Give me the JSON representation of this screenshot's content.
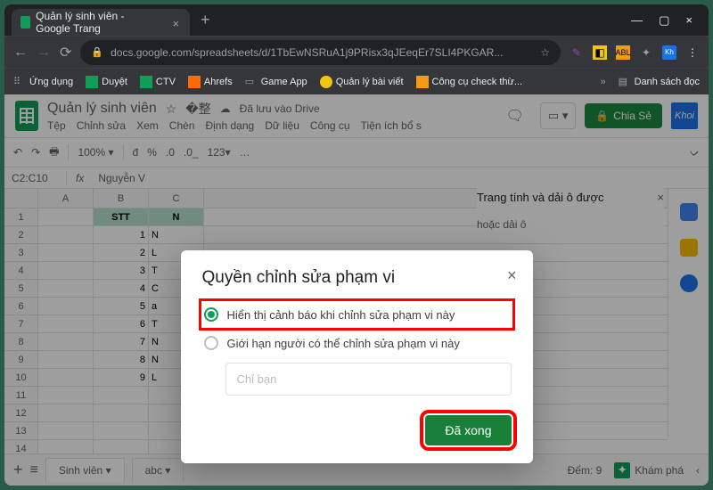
{
  "browser": {
    "tab_title": "Quản lý sinh viên - Google Trang",
    "url": "docs.google.com/spreadsheets/d/1TbEwNSRuA1j9PRisx3qJEeqEr7SLI4PKGAR...",
    "bookmarks": {
      "apps": "Ứng dụng",
      "items": [
        "Duyệt",
        "CTV",
        "Ahrefs",
        "Game App",
        "Quản lý bài viết",
        "Công cụ check thừ..."
      ],
      "overflow": "»",
      "reading_list": "Danh sách đọc"
    }
  },
  "doc": {
    "title": "Quản lý sinh viên",
    "saved": "Đã lưu vào Drive",
    "menus": [
      "Tệp",
      "Chỉnh sửa",
      "Xem",
      "Chèn",
      "Định dạng",
      "Dữ liệu",
      "Công cụ",
      "Tiện ích bổ s"
    ],
    "share": "Chia Sẻ",
    "avatar": "Khoi"
  },
  "toolbar": {
    "zoom": "100%",
    "currency": "đ",
    "percent": "%",
    "dec_dec": ".0",
    "dec_inc": ".0_",
    "num_format": "123",
    "more": "…",
    "expand": "ᨆ"
  },
  "formula": {
    "name_box": "C2:C10",
    "fx": "fx",
    "value": "Nguyễn V"
  },
  "grid": {
    "columns": [
      "A",
      "B",
      "C"
    ],
    "header_row": {
      "b": "STT",
      "c": "N"
    },
    "rows": [
      {
        "n": "1",
        "b": "",
        "c": ""
      },
      {
        "n": "2",
        "b": "1",
        "c": "N"
      },
      {
        "n": "3",
        "b": "2",
        "c": "L"
      },
      {
        "n": "4",
        "b": "3",
        "c": "T"
      },
      {
        "n": "5",
        "b": "4",
        "c": "C"
      },
      {
        "n": "6",
        "b": "5",
        "c": "a"
      },
      {
        "n": "7",
        "b": "6",
        "c": "T"
      },
      {
        "n": "8",
        "b": "7",
        "c": "N"
      },
      {
        "n": "9",
        "b": "8",
        "c": "N"
      },
      {
        "n": "10",
        "b": "9",
        "c": "L"
      },
      {
        "n": "11",
        "b": "",
        "c": ""
      },
      {
        "n": "12",
        "b": "",
        "c": ""
      },
      {
        "n": "13",
        "b": "",
        "c": ""
      },
      {
        "n": "14",
        "b": "",
        "c": ""
      }
    ]
  },
  "side_panel": {
    "title": "Trang tính và dải ô được",
    "subtitle": "hoặc dải ô"
  },
  "status": {
    "add": "+",
    "menu": "≡",
    "sheet1": "Sinh viên",
    "sheet2": "abc",
    "count": "Đếm: 9",
    "explore": "Khám phá"
  },
  "dialog": {
    "title": "Quyền chỉnh sửa phạm vi",
    "option_warn": "Hiển thị cảnh báo khi chỉnh sửa phạm vi này",
    "option_restrict": "Giới hạn người có thể chỉnh sửa phạm vi này",
    "restrict_placeholder": "Chỉ bạn",
    "done": "Đã xong"
  }
}
